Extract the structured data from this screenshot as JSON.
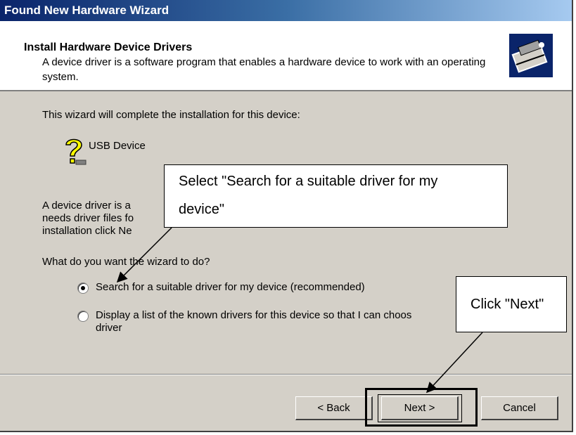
{
  "window": {
    "title": "Found New Hardware Wizard",
    "header_title": "Install Hardware Device Drivers",
    "header_subtitle": "A device driver is a software program that enables a hardware device to work with an operating system.",
    "header_icon": "hardware-install-icon"
  },
  "content": {
    "intro": "This wizard will complete the installation for this device:",
    "device_icon": "question-device-icon",
    "device_name": "USB Device",
    "driver_text_line1": "A device driver is a",
    "driver_text_line2": "needs driver files fo",
    "driver_text_line3": "installation click Ne",
    "question": "What do you want the wizard to do?",
    "options": [
      {
        "label": "Search for a suitable driver for my device (recommended)",
        "selected": true
      },
      {
        "label_line1": "Display a list of the known drivers for this device so that I can choos",
        "label_line2": "driver",
        "selected": false
      }
    ]
  },
  "buttons": {
    "back": "< Back",
    "next": "Next >",
    "cancel": "Cancel"
  },
  "annotations": {
    "callout1_line1": "Select \"Search for a suitable driver for my",
    "callout1_line2": "device\"",
    "callout2": "Click \"Next\""
  }
}
